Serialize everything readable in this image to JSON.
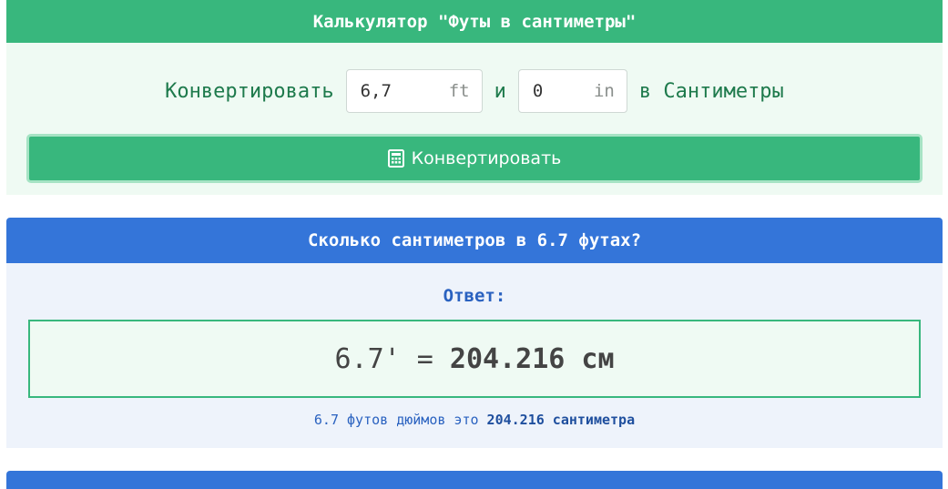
{
  "converter": {
    "title": "Калькулятор \"Футы в сантиметры\"",
    "prefix": "Конвертировать",
    "feet_value": "6,7",
    "feet_unit": "ft",
    "joiner": "и",
    "inches_value": "0",
    "inches_unit": "in",
    "suffix": "в Сантиметры",
    "button_label": "Конвертировать",
    "button_icon": "calculator-icon"
  },
  "answer": {
    "title": "Сколько сантиметров в 6.7 футах?",
    "label": "Ответ:",
    "result_left": "6.7' = ",
    "result_value": "204.216 см",
    "note_prefix": "6.7 футов дюймов это ",
    "note_value": "204.216 сантиметра"
  },
  "colors": {
    "green_accent": "#38b77d",
    "blue_accent": "#3475d9"
  }
}
